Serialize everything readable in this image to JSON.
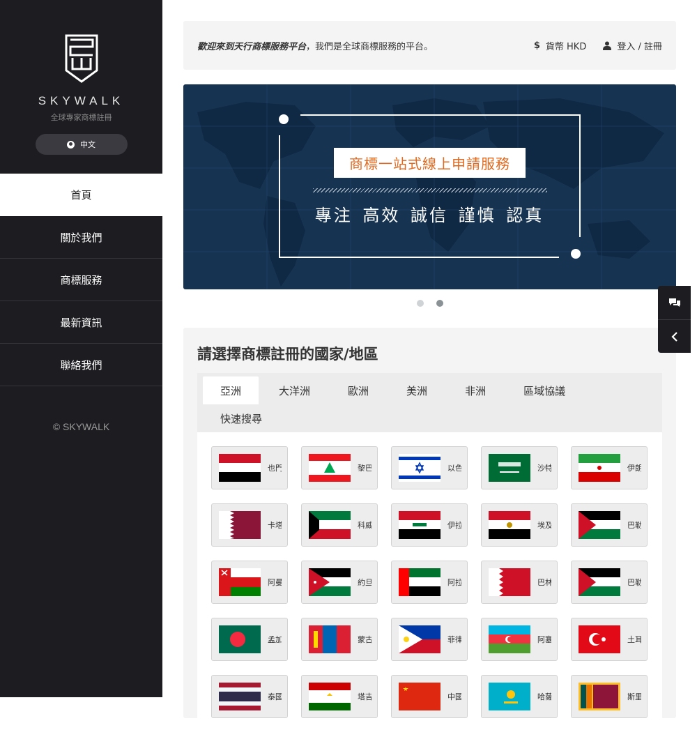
{
  "sidebar": {
    "brand_name": "SKYWALK",
    "brand_tagline": "全球專家商標註冊",
    "language_label": "中文",
    "nav": [
      {
        "label": "首頁",
        "active": true
      },
      {
        "label": "關於我們"
      },
      {
        "label": "商標服務"
      },
      {
        "label": "最新資訊"
      },
      {
        "label": "聯絡我們"
      }
    ],
    "copyright": "© SKYWALK"
  },
  "topbar": {
    "welcome_bold": "歡迎來到天行商標服務平台",
    "welcome_rest": "，我們是全球商標服務的平台。",
    "currency_icon": "$",
    "currency_label": "貨幣 HKD",
    "login_label": "登入 / 註冊"
  },
  "banner": {
    "title": "商標一站式線上申請服務",
    "subtitle": "專注 高效 誠信 謹慎 認真",
    "slide_count": 2,
    "active_slide": 2
  },
  "region_section": {
    "heading": "請選擇商標註冊的國家/地區",
    "tabs": [
      "亞洲",
      "大洋洲",
      "歐洲",
      "美洲",
      "非洲",
      "區域協議",
      "快速搜尋"
    ],
    "active_tab": "亞洲",
    "countries": [
      {
        "name": "也門",
        "flag": "yemen-flag"
      },
      {
        "name": "黎巴嫩",
        "flag": "lebanon-flag"
      },
      {
        "name": "以色列",
        "flag": "israel-flag"
      },
      {
        "name": "沙特",
        "flag": "saudi-arabia-flag"
      },
      {
        "name": "伊朗",
        "flag": "iran-flag"
      },
      {
        "name": "卡塔爾",
        "flag": "qatar-flag"
      },
      {
        "name": "科威特",
        "flag": "kuwait-flag"
      },
      {
        "name": "伊拉克",
        "flag": "iraq-flag"
      },
      {
        "name": "埃及",
        "flag": "egypt-flag"
      },
      {
        "name": "巴勒斯坦",
        "flag": "palestine-flag"
      },
      {
        "name": "阿曼",
        "flag": "oman-flag"
      },
      {
        "name": "約旦",
        "flag": "jordan-flag"
      },
      {
        "name": "阿拉伯聯合酋長國",
        "flag": "uae-flag"
      },
      {
        "name": "巴林",
        "flag": "bahrain-flag"
      },
      {
        "name": "巴勒斯坦",
        "flag": "palestine-flag"
      },
      {
        "name": "孟加拉",
        "flag": "bangladesh-flag"
      },
      {
        "name": "蒙古",
        "flag": "mongolia-flag"
      },
      {
        "name": "菲律賓",
        "flag": "philippines-flag"
      },
      {
        "name": "阿塞拜疆",
        "flag": "azerbaijan-flag"
      },
      {
        "name": "土耳其",
        "flag": "turkey-flag"
      },
      {
        "name": "泰國",
        "flag": "thailand-flag"
      },
      {
        "name": "塔吉克斯坦",
        "flag": "tajikistan-flag"
      },
      {
        "name": "中國",
        "flag": "china-flag"
      },
      {
        "name": "哈薩克斯坦",
        "flag": "kazakhstan-flag"
      },
      {
        "name": "斯里蘭卡",
        "flag": "sri-lanka-flag"
      }
    ]
  },
  "float_tools": [
    "chat-icon",
    "chevron-left-icon"
  ],
  "colors": {
    "sidebar_bg": "#1c1c21",
    "banner_bg": "#163452",
    "banner_title_text": "#e06a20",
    "panel_bg": "#f4f4f4"
  }
}
